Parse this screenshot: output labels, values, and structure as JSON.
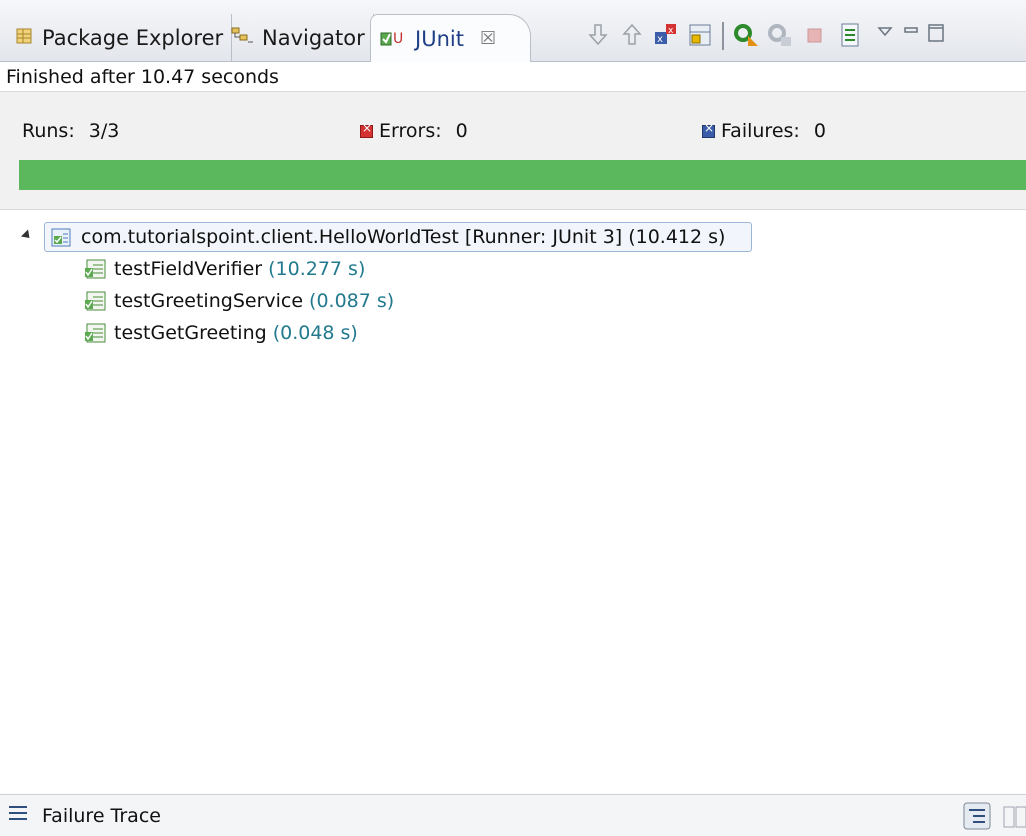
{
  "tabs": [
    {
      "label": "Package Explorer",
      "icon": "package-explorer-icon"
    },
    {
      "label": "Navigator",
      "icon": "navigator-icon"
    },
    {
      "label": "JUnit",
      "icon": "junit-icon",
      "close": "☒",
      "active": true
    }
  ],
  "toolbar": [
    "next-failure-icon",
    "previous-failure-icon",
    "show-failures-only-icon",
    "scroll-lock-icon",
    "rerun-test-icon",
    "rerun-failed-first-icon",
    "stop-icon",
    "test-run-history-icon",
    "view-menu-icon",
    "minimize-icon",
    "maximize-icon"
  ],
  "status": {
    "text": "Finished after 10.47 seconds"
  },
  "counters": {
    "runs_label": "Runs:",
    "runs_value": "3/3",
    "errors_label": "Errors:",
    "errors_value": "0",
    "failures_label": "Failures:",
    "failures_value": "0"
  },
  "progress": {
    "fraction": 1.0,
    "color": "#5cb85c"
  },
  "tree": {
    "root": {
      "name": "com.tutorialspoint.client.HelloWorldTest [Runner: JUnit 3]",
      "time": "(10.412 s)"
    },
    "tests": [
      {
        "name": "testFieldVerifier",
        "time": "(10.277 s)"
      },
      {
        "name": "testGreetingService",
        "time": "(0.087 s)"
      },
      {
        "name": "testGetGreeting",
        "time": "(0.048 s)"
      }
    ]
  },
  "trace": {
    "label": "Failure Trace"
  },
  "colors": {
    "time": "#237a8f",
    "error": "#d53232",
    "failure": "#3b5ca8",
    "pass": "#5cb85c"
  }
}
